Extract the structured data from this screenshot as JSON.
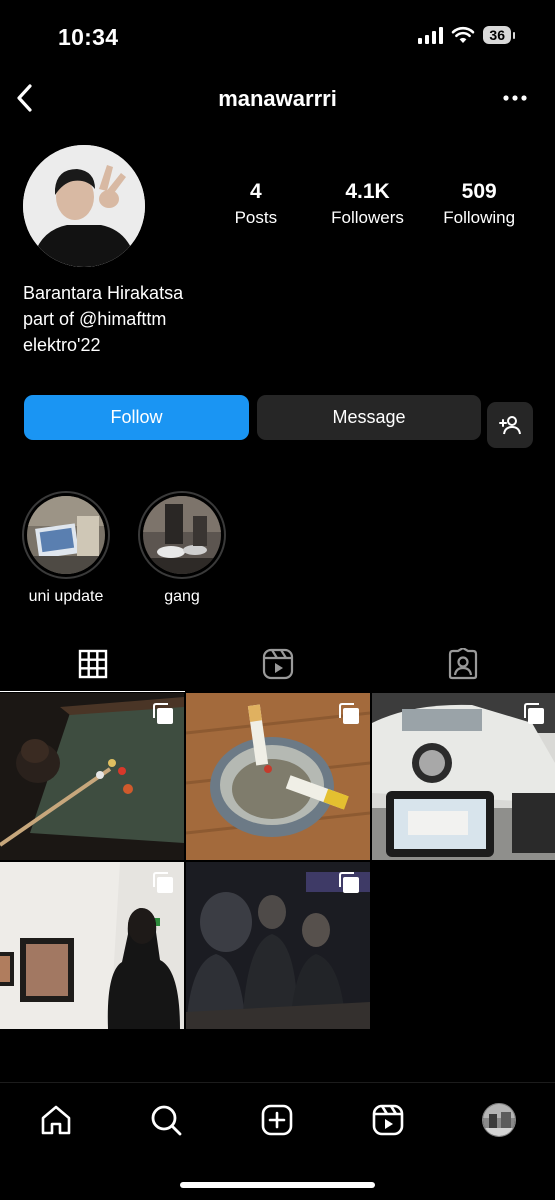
{
  "status_bar": {
    "time": "10:34",
    "battery": "36"
  },
  "header": {
    "username": "manawarrri"
  },
  "profile": {
    "stats": [
      {
        "value": "4",
        "label": "Posts"
      },
      {
        "value": "4.1K",
        "label": "Followers"
      },
      {
        "value": "509",
        "label": "Following"
      }
    ],
    "bio": {
      "name": "Barantara Hirakatsa",
      "line1": "part of @himafttm",
      "line2": "elektro'22"
    }
  },
  "actions": {
    "follow_label": "Follow",
    "message_label": "Message"
  },
  "highlights": [
    {
      "label": "uni update"
    },
    {
      "label": "gang"
    }
  ],
  "tabs": [
    {
      "icon": "grid-icon",
      "active": true
    },
    {
      "icon": "reels-icon",
      "active": false
    },
    {
      "icon": "tagged-icon",
      "active": false
    }
  ],
  "posts": [
    {
      "name": "post-billiards",
      "multi": true
    },
    {
      "name": "post-ashtray",
      "multi": true
    },
    {
      "name": "post-car",
      "multi": true
    },
    {
      "name": "post-gallery",
      "multi": true
    },
    {
      "name": "post-night-group",
      "multi": true
    }
  ],
  "bottom_nav": [
    "home-icon",
    "search-icon",
    "create-icon",
    "reels-icon",
    "profile-avatar"
  ],
  "colors": {
    "accent": "#1a95f3",
    "background": "#000000",
    "secondary_button": "#262626"
  }
}
